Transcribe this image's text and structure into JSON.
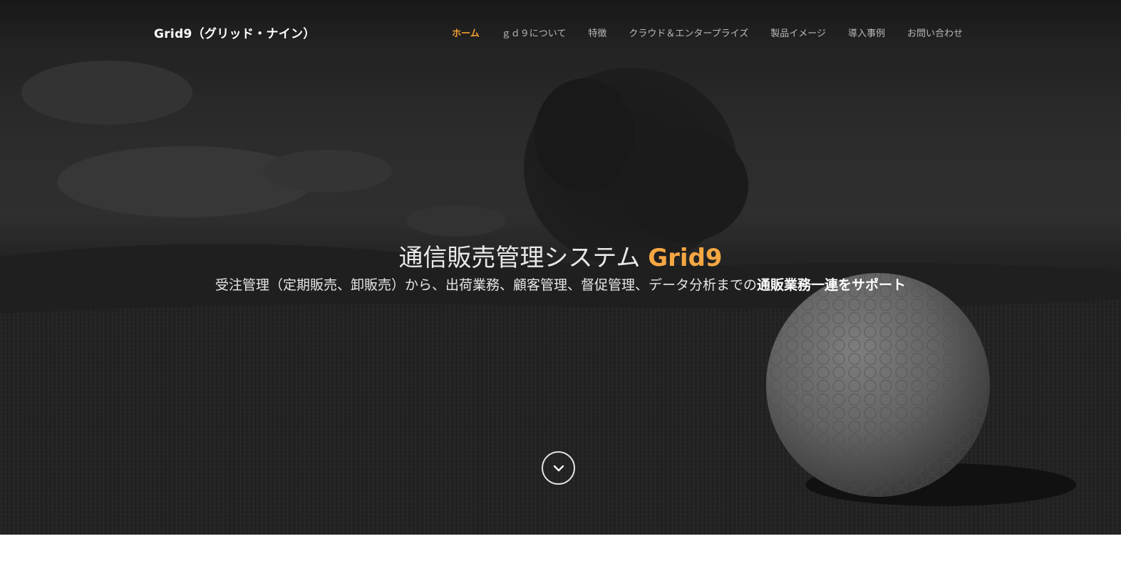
{
  "brand": {
    "name": "Grid9（グリッド・ナイン）"
  },
  "nav": {
    "items": [
      {
        "label": "ホーム",
        "active": true
      },
      {
        "label": "ｇｄ９について",
        "active": false
      },
      {
        "label": "特徴",
        "active": false
      },
      {
        "label": "クラウド＆エンタープライズ",
        "active": false
      },
      {
        "label": "製品イメージ",
        "active": false
      },
      {
        "label": "導入事例",
        "active": false
      },
      {
        "label": "お問い合わせ",
        "active": false
      }
    ]
  },
  "hero": {
    "title_main": "通信販売管理システム ",
    "title_accent": "Grid9",
    "subtitle_main": "受注管理（定期販売、卸販売）から、出荷業務、顧客管理、督促管理、データ分析までの",
    "subtitle_bold": "通販業務一連をサポート",
    "scroll_icon": "chevron-down-icon"
  },
  "colors": {
    "accent": "#f5a742",
    "nav_active": "#f0a030",
    "nav_text": "#b9b9b9",
    "overlay": "#2a2a2a"
  }
}
